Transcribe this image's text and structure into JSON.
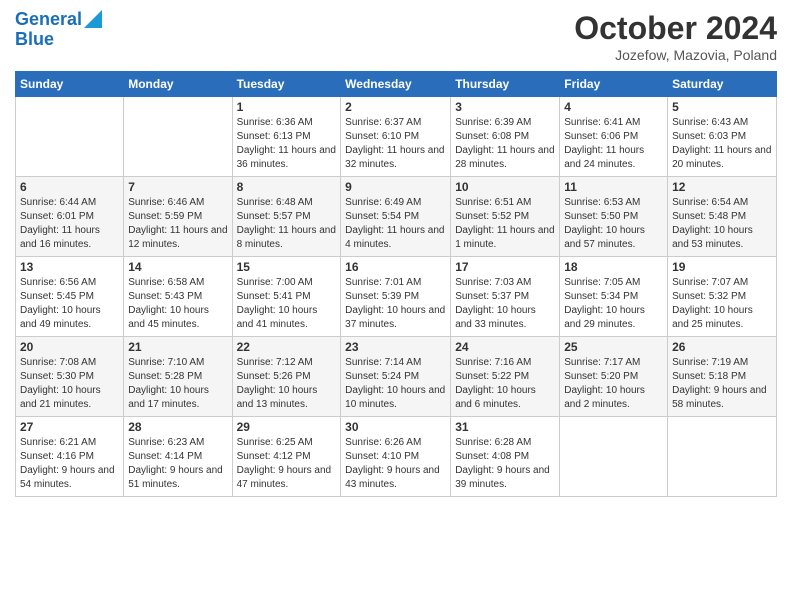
{
  "logo": {
    "line1": "General",
    "line2": "Blue"
  },
  "header": {
    "month": "October 2024",
    "location": "Jozefow, Mazovia, Poland"
  },
  "weekdays": [
    "Sunday",
    "Monday",
    "Tuesday",
    "Wednesday",
    "Thursday",
    "Friday",
    "Saturday"
  ],
  "weeks": [
    [
      {
        "day": "",
        "info": ""
      },
      {
        "day": "",
        "info": ""
      },
      {
        "day": "1",
        "info": "Sunrise: 6:36 AM\nSunset: 6:13 PM\nDaylight: 11 hours and 36 minutes."
      },
      {
        "day": "2",
        "info": "Sunrise: 6:37 AM\nSunset: 6:10 PM\nDaylight: 11 hours and 32 minutes."
      },
      {
        "day": "3",
        "info": "Sunrise: 6:39 AM\nSunset: 6:08 PM\nDaylight: 11 hours and 28 minutes."
      },
      {
        "day": "4",
        "info": "Sunrise: 6:41 AM\nSunset: 6:06 PM\nDaylight: 11 hours and 24 minutes."
      },
      {
        "day": "5",
        "info": "Sunrise: 6:43 AM\nSunset: 6:03 PM\nDaylight: 11 hours and 20 minutes."
      }
    ],
    [
      {
        "day": "6",
        "info": "Sunrise: 6:44 AM\nSunset: 6:01 PM\nDaylight: 11 hours and 16 minutes."
      },
      {
        "day": "7",
        "info": "Sunrise: 6:46 AM\nSunset: 5:59 PM\nDaylight: 11 hours and 12 minutes."
      },
      {
        "day": "8",
        "info": "Sunrise: 6:48 AM\nSunset: 5:57 PM\nDaylight: 11 hours and 8 minutes."
      },
      {
        "day": "9",
        "info": "Sunrise: 6:49 AM\nSunset: 5:54 PM\nDaylight: 11 hours and 4 minutes."
      },
      {
        "day": "10",
        "info": "Sunrise: 6:51 AM\nSunset: 5:52 PM\nDaylight: 11 hours and 1 minute."
      },
      {
        "day": "11",
        "info": "Sunrise: 6:53 AM\nSunset: 5:50 PM\nDaylight: 10 hours and 57 minutes."
      },
      {
        "day": "12",
        "info": "Sunrise: 6:54 AM\nSunset: 5:48 PM\nDaylight: 10 hours and 53 minutes."
      }
    ],
    [
      {
        "day": "13",
        "info": "Sunrise: 6:56 AM\nSunset: 5:45 PM\nDaylight: 10 hours and 49 minutes."
      },
      {
        "day": "14",
        "info": "Sunrise: 6:58 AM\nSunset: 5:43 PM\nDaylight: 10 hours and 45 minutes."
      },
      {
        "day": "15",
        "info": "Sunrise: 7:00 AM\nSunset: 5:41 PM\nDaylight: 10 hours and 41 minutes."
      },
      {
        "day": "16",
        "info": "Sunrise: 7:01 AM\nSunset: 5:39 PM\nDaylight: 10 hours and 37 minutes."
      },
      {
        "day": "17",
        "info": "Sunrise: 7:03 AM\nSunset: 5:37 PM\nDaylight: 10 hours and 33 minutes."
      },
      {
        "day": "18",
        "info": "Sunrise: 7:05 AM\nSunset: 5:34 PM\nDaylight: 10 hours and 29 minutes."
      },
      {
        "day": "19",
        "info": "Sunrise: 7:07 AM\nSunset: 5:32 PM\nDaylight: 10 hours and 25 minutes."
      }
    ],
    [
      {
        "day": "20",
        "info": "Sunrise: 7:08 AM\nSunset: 5:30 PM\nDaylight: 10 hours and 21 minutes."
      },
      {
        "day": "21",
        "info": "Sunrise: 7:10 AM\nSunset: 5:28 PM\nDaylight: 10 hours and 17 minutes."
      },
      {
        "day": "22",
        "info": "Sunrise: 7:12 AM\nSunset: 5:26 PM\nDaylight: 10 hours and 13 minutes."
      },
      {
        "day": "23",
        "info": "Sunrise: 7:14 AM\nSunset: 5:24 PM\nDaylight: 10 hours and 10 minutes."
      },
      {
        "day": "24",
        "info": "Sunrise: 7:16 AM\nSunset: 5:22 PM\nDaylight: 10 hours and 6 minutes."
      },
      {
        "day": "25",
        "info": "Sunrise: 7:17 AM\nSunset: 5:20 PM\nDaylight: 10 hours and 2 minutes."
      },
      {
        "day": "26",
        "info": "Sunrise: 7:19 AM\nSunset: 5:18 PM\nDaylight: 9 hours and 58 minutes."
      }
    ],
    [
      {
        "day": "27",
        "info": "Sunrise: 6:21 AM\nSunset: 4:16 PM\nDaylight: 9 hours and 54 minutes."
      },
      {
        "day": "28",
        "info": "Sunrise: 6:23 AM\nSunset: 4:14 PM\nDaylight: 9 hours and 51 minutes."
      },
      {
        "day": "29",
        "info": "Sunrise: 6:25 AM\nSunset: 4:12 PM\nDaylight: 9 hours and 47 minutes."
      },
      {
        "day": "30",
        "info": "Sunrise: 6:26 AM\nSunset: 4:10 PM\nDaylight: 9 hours and 43 minutes."
      },
      {
        "day": "31",
        "info": "Sunrise: 6:28 AM\nSunset: 4:08 PM\nDaylight: 9 hours and 39 minutes."
      },
      {
        "day": "",
        "info": ""
      },
      {
        "day": "",
        "info": ""
      }
    ]
  ]
}
